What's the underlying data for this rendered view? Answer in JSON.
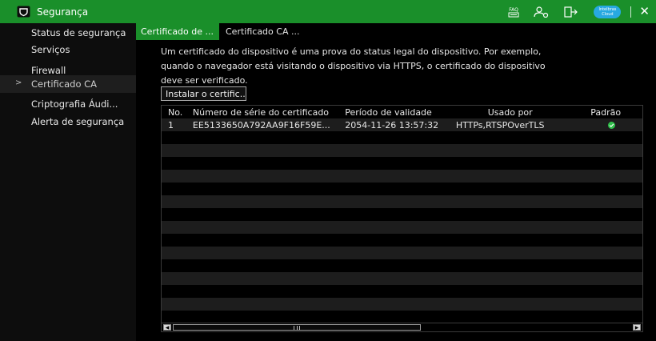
{
  "titlebar": {
    "title": "Segurança",
    "faq_label": "FAQ",
    "cloud_label_top": "Intelbras",
    "cloud_label_bottom": "Cloud",
    "close_glyph": "✕",
    "icons": [
      "shield-icon",
      "faq-icon",
      "user-settings-icon",
      "logout-icon",
      "cloud-icon",
      "close-icon"
    ],
    "accent_color": "#1a8f2a"
  },
  "sidebar": {
    "items": [
      {
        "label": "Status de segurança",
        "active": false
      },
      {
        "label": "Serviços",
        "active": false
      },
      {
        "label": "Firewall",
        "active": false
      },
      {
        "label": "Certificado CA",
        "active": true,
        "marker": ">"
      },
      {
        "label": "Criptografia Áudi...",
        "active": false
      },
      {
        "label": "Alerta de segurança",
        "active": false
      }
    ]
  },
  "tabs": [
    {
      "label": "Certificado de ...",
      "active": true
    },
    {
      "label": "Certificado CA ...",
      "active": false
    }
  ],
  "description": {
    "line1": "Um certificado do dispositivo é uma prova do status legal do dispositivo. Por exemplo,",
    "line2": "quando o navegador está visitando o dispositivo via HTTPS, o certificado do dispositivo",
    "line3": "deve ser verificado."
  },
  "install_button": "Instalar o certific...",
  "table": {
    "headers": {
      "no": "No.",
      "serial": "Número de série do certificado",
      "period": "Período de validade",
      "used_by": "Usado por",
      "default": "Padrão"
    },
    "rows": [
      {
        "no": "1",
        "serial": "EE5133650A792AA9F16F59E...",
        "period": "2054-11-26 13:57:32",
        "used_by": "HTTPs,RTSPOverTLS",
        "default": true
      }
    ],
    "empty_rows": 16,
    "check_color": "#2fbf4a"
  }
}
